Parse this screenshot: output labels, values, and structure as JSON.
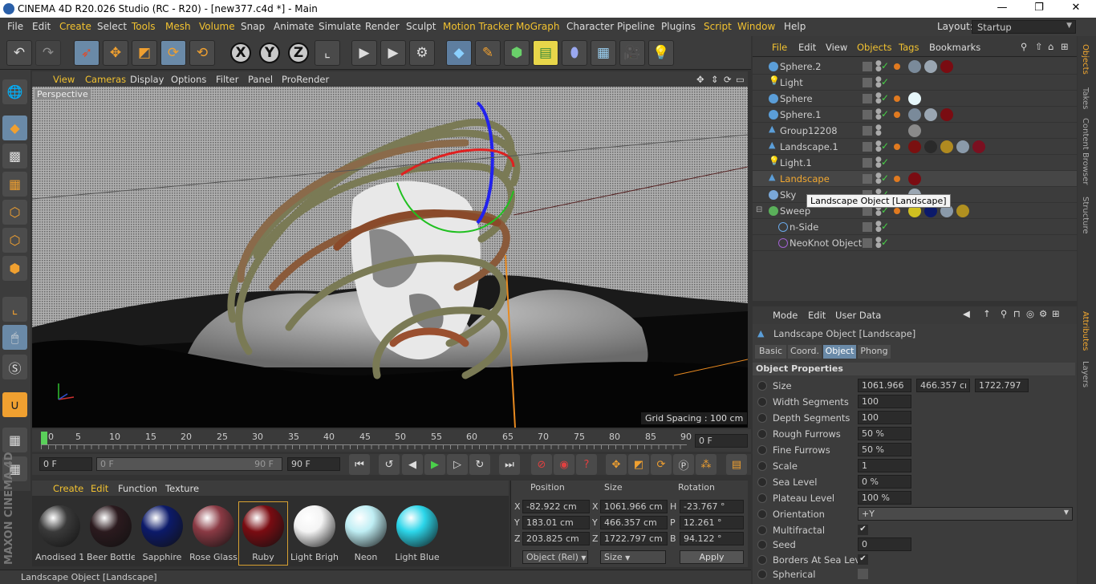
{
  "window": {
    "title": "CINEMA 4D R20.026 Studio (RC - R20) - [new377.c4d *] - Main",
    "minimize": "—",
    "maximize": "❐",
    "close": "✕"
  },
  "menubar": {
    "items": [
      "File",
      "Edit",
      "Create",
      "Select",
      "Tools",
      "Mesh",
      "Volume",
      "Snap",
      "Animate",
      "Simulate",
      "Render",
      "Sculpt",
      "Motion Tracker",
      "MoGraph",
      "Character",
      "Pipeline",
      "Plugins",
      "Script",
      "Window",
      "Help"
    ],
    "layout_label": "Layout:",
    "layout_value": "Startup"
  },
  "viewport": {
    "menu": [
      "View",
      "Cameras",
      "Display",
      "Options",
      "Filter",
      "Panel",
      "ProRender"
    ],
    "camera_label": "Perspective",
    "grid_spacing": "Grid Spacing : 100 cm"
  },
  "timeline": {
    "ticks": [
      "0",
      "5",
      "10",
      "15",
      "20",
      "25",
      "30",
      "35",
      "40",
      "45",
      "50",
      "55",
      "60",
      "65",
      "70",
      "75",
      "80",
      "85",
      "90"
    ],
    "current_frame": "0 F",
    "start": "0 F",
    "range_start": "0 F",
    "range_end": "90 F",
    "end": "90 F"
  },
  "materials": {
    "menu": [
      "Create",
      "Edit",
      "Function",
      "Texture"
    ],
    "items": [
      {
        "name": "Anodised 1",
        "color": "#3a3a3a"
      },
      {
        "name": "Beer Bottle",
        "color": "#2b1a1e"
      },
      {
        "name": "Sapphire",
        "color": "#0c1a6a"
      },
      {
        "name": "Rose Glass",
        "color": "#8a3a44"
      },
      {
        "name": "Ruby",
        "color": "#7a0c12"
      },
      {
        "name": "Light Brigh",
        "color": "#f4f4f4"
      },
      {
        "name": "Neon",
        "color": "#bfeef4"
      },
      {
        "name": "Light Blue",
        "color": "#2cd6ea"
      }
    ]
  },
  "coordinates": {
    "headers": [
      "Position",
      "Size",
      "Rotation"
    ],
    "rows": [
      {
        "axis": "X",
        "pos": "-82.922 cm",
        "saxis": "X",
        "size": "1061.966 cm",
        "raxis": "H",
        "rot": "-23.767 °"
      },
      {
        "axis": "Y",
        "pos": "183.01 cm",
        "saxis": "Y",
        "size": "466.357 cm",
        "raxis": "P",
        "rot": "12.261 °"
      },
      {
        "axis": "Z",
        "pos": "203.825 cm",
        "saxis": "Z",
        "size": "1722.797 cm",
        "raxis": "B",
        "rot": "94.122 °"
      }
    ],
    "mode": "Object (Rel)",
    "size_mode": "Size",
    "apply": "Apply"
  },
  "object_manager": {
    "menu": [
      "File",
      "Edit",
      "View",
      "Objects",
      "Tags",
      "Bookmarks"
    ],
    "objects": [
      {
        "name": "Sphere.2",
        "active": false
      },
      {
        "name": "Light",
        "active": false
      },
      {
        "name": "Sphere",
        "active": false
      },
      {
        "name": "Sphere.1",
        "active": false
      },
      {
        "name": "Group12208",
        "active": false
      },
      {
        "name": "Landscape.1",
        "active": false
      },
      {
        "name": "Light.1",
        "active": false
      },
      {
        "name": "Landscape",
        "active": true
      },
      {
        "name": "Sky",
        "active": false
      },
      {
        "name": "Sweep",
        "active": false
      },
      {
        "name": "n-Side",
        "active": false
      },
      {
        "name": "NeoKnot Object",
        "active": false
      }
    ],
    "tooltip": "Landscape Object [Landscape]"
  },
  "attributes": {
    "menu": [
      "Mode",
      "Edit",
      "User Data"
    ],
    "object_title": "Landscape Object [Landscape]",
    "tabs": [
      "Basic",
      "Coord.",
      "Object",
      "Phong"
    ],
    "active_tab": "Object",
    "section": "Object Properties",
    "properties": {
      "size": {
        "label": "Size",
        "x": "1061.966",
        "y": "466.357 cı",
        "z": "1722.797"
      },
      "width_segments": {
        "label": "Width Segments",
        "value": "100"
      },
      "depth_segments": {
        "label": "Depth Segments",
        "value": "100"
      },
      "rough_furrows": {
        "label": "Rough Furrows",
        "value": "50 %"
      },
      "fine_furrows": {
        "label": "Fine Furrows",
        "value": "50 %"
      },
      "scale": {
        "label": "Scale",
        "value": "1"
      },
      "sea_level": {
        "label": "Sea Level",
        "value": "0 %"
      },
      "plateau_level": {
        "label": "Plateau Level",
        "value": "100 %"
      },
      "orientation": {
        "label": "Orientation",
        "value": "+Y"
      },
      "multifractal": {
        "label": "Multifractal",
        "value": "✔"
      },
      "seed": {
        "label": "Seed",
        "value": "0"
      },
      "borders_at_sea_level": {
        "label": "Borders At Sea Level",
        "value": "✔"
      },
      "spherical": {
        "label": "Spherical",
        "value": ""
      }
    }
  },
  "right_tabs": [
    "Objects",
    "Takes",
    "Content Browser",
    "Structure",
    "Attributes",
    "Layers"
  ],
  "status": "Landscape Object [Landscape]",
  "brand": "MAXON CINEMA 4D"
}
